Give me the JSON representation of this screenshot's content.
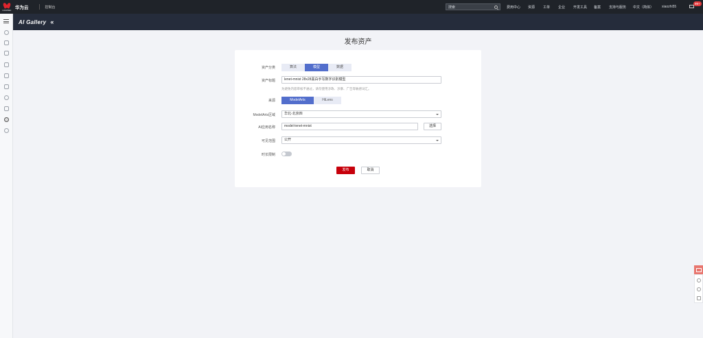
{
  "topbar": {
    "logo_text": "HUAWEI",
    "brand": "华为云",
    "console": "控制台",
    "search_placeholder": "搜索",
    "nav": [
      "费用中心",
      "资源",
      "工单",
      "企业",
      "开发工具",
      "备案",
      "支持与服务",
      "中文（简体）",
      "xiaozhi55"
    ],
    "message_count": "99+"
  },
  "subheader": {
    "title": "AI Gallery"
  },
  "page": {
    "title": "发布资产"
  },
  "form": {
    "category": {
      "label": "资产分类",
      "options": [
        "算法",
        "模型",
        "数据"
      ],
      "selected": "模型"
    },
    "title_field": {
      "label": "资产标题",
      "value": "lenet-mnist 28x28黑白手写数字识别模型",
      "hint": "为避免内容审核不通过，请勿使用涉政、涉暴、广告等敏感词汇。"
    },
    "source": {
      "label": "来源",
      "options": [
        "ModelArts",
        "HiLens"
      ],
      "selected": "ModelArts"
    },
    "region": {
      "label": "ModelArts区域",
      "value": "华北-北京四"
    },
    "app_name": {
      "label": "AI应用名称",
      "value": "model-lenet-mnist",
      "button": "选择"
    },
    "visibility": {
      "label": "可见范围",
      "value": "公开"
    },
    "time_limit": {
      "label": "时长限制",
      "enabled": false
    },
    "publish": "发布",
    "cancel": "取消"
  },
  "colors": {
    "primary": "#526ecc",
    "publish": "#c7000b",
    "topbar": "#1f2329",
    "subheader": "#252c3b"
  }
}
